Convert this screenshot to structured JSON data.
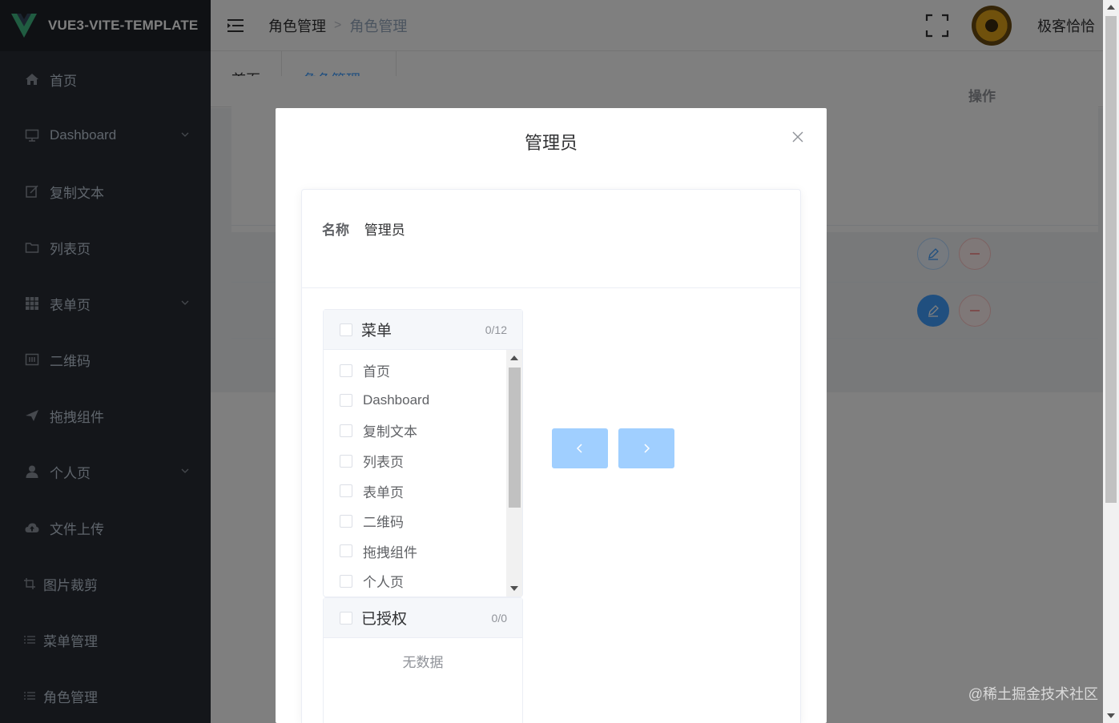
{
  "app": {
    "logo_text": "VUE3-VITE-TEMPLATE"
  },
  "sidebar": {
    "items": [
      {
        "label": "首页",
        "icon": "home-icon"
      },
      {
        "label": "Dashboard",
        "icon": "dashboard-icon",
        "has_children": true
      },
      {
        "label": "复制文本",
        "icon": "edit-icon"
      },
      {
        "label": "列表页",
        "icon": "folder-icon"
      },
      {
        "label": "表单页",
        "icon": "grid-icon",
        "has_children": true
      },
      {
        "label": "二维码",
        "icon": "qrcode-icon"
      },
      {
        "label": "拖拽组件",
        "icon": "send-icon"
      },
      {
        "label": "个人页",
        "icon": "user-icon",
        "has_children": true
      },
      {
        "label": "文件上传",
        "icon": "cloud-upload-icon"
      },
      {
        "label": "图片裁剪",
        "icon": "crop-icon"
      },
      {
        "label": "菜单管理",
        "icon": "list-icon"
      },
      {
        "label": "角色管理",
        "icon": "list-icon"
      }
    ]
  },
  "header": {
    "breadcrumb": [
      "角色管理",
      "角色管理"
    ],
    "username": "极客恰恰"
  },
  "tabs": [
    {
      "label": "首页",
      "active": false
    },
    {
      "label": "角色管理",
      "active": true,
      "close": "×"
    }
  ],
  "table": {
    "action_header": "操作"
  },
  "dialog": {
    "title": "管理员",
    "name_label": "名称",
    "name_value": "管理员",
    "left_panel": {
      "title": "菜单",
      "count": "0/12",
      "items": [
        "首页",
        "Dashboard",
        "复制文本",
        "列表页",
        "表单页",
        "二维码",
        "拖拽组件",
        "个人页"
      ]
    },
    "right_panel": {
      "title": "已授权",
      "count": "0/0",
      "empty_text": "无数据"
    }
  },
  "watermark": "@稀土掘金技术社区",
  "colors": {
    "sidebar_bg": "#282c34",
    "primary": "#409eff",
    "primary_light": "#a0cfff",
    "danger": "#f56c6c"
  }
}
